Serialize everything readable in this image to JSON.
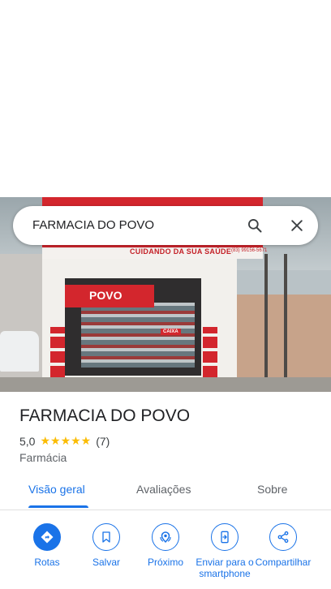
{
  "search": {
    "query": "FARMACIA DO POVO"
  },
  "photo": {
    "sign_text": "CUIDANDO DA SUA SAÚDE",
    "sign_phone": "(83) 99156-5671",
    "panel_text": "POVO",
    "caixa_text": "CAIXA"
  },
  "place": {
    "name": "FARMACIA DO POVO",
    "rating": "5,0",
    "stars": "★★★★★",
    "review_count": "(7)",
    "category": "Farmácia"
  },
  "tabs": [
    {
      "label": "Visão geral",
      "active": true
    },
    {
      "label": "Avaliações",
      "active": false
    },
    {
      "label": "Sobre",
      "active": false
    }
  ],
  "actions": [
    {
      "label": "Rotas",
      "icon": "directions-icon"
    },
    {
      "label": "Salvar",
      "icon": "bookmark-icon"
    },
    {
      "label": "Próximo",
      "icon": "nearby-icon"
    },
    {
      "label": "Enviar para o smartphone",
      "icon": "send-to-phone-icon"
    },
    {
      "label": "Compartilhar",
      "icon": "share-icon"
    }
  ],
  "colors": {
    "accent": "#1a73e8",
    "star": "#fbbc04"
  }
}
